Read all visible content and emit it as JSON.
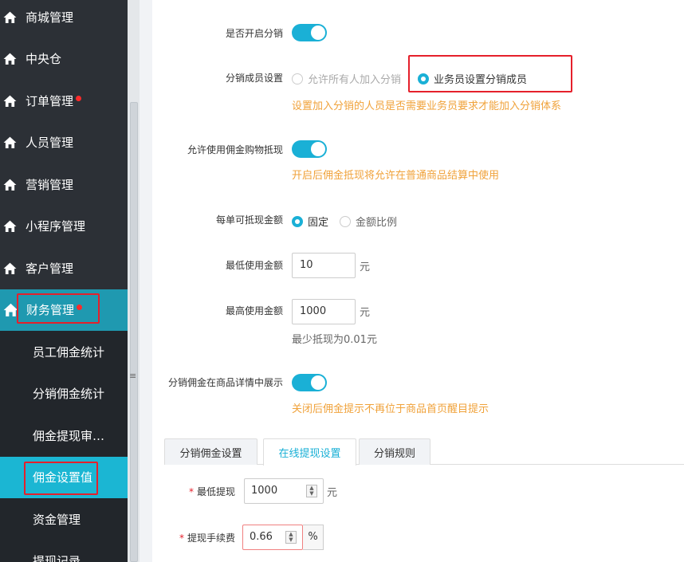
{
  "sidebar": {
    "items": [
      {
        "label": "商城管理"
      },
      {
        "label": "中央仓"
      },
      {
        "label": "订单管理"
      },
      {
        "label": "人员管理"
      },
      {
        "label": "营销管理"
      },
      {
        "label": "小程序管理"
      },
      {
        "label": "客户管理"
      },
      {
        "label": "财务管理"
      }
    ],
    "subitems": [
      {
        "label": "员工佣金统计"
      },
      {
        "label": "分销佣金统计"
      },
      {
        "label": "佣金提现审…"
      },
      {
        "label": "佣金设置值"
      },
      {
        "label": "资金管理"
      },
      {
        "label": "提现记录"
      }
    ],
    "splitter_grip": "≡"
  },
  "form": {
    "enable_distribution": {
      "label": "是否开启分销",
      "on": true
    },
    "member_setting": {
      "label": "分销成员设置",
      "options": [
        "允许所有人加入分销",
        "业务员设置分销成员"
      ],
      "selected": "业务员设置分销成员",
      "hint": "设置加入分销的人员是否需要业务员要求才能加入分销体系"
    },
    "commission_offset": {
      "label": "允许使用佣金购物抵现",
      "on": true,
      "hint": "开启后佣金抵现将允许在普通商品结算中使用"
    },
    "offset_amount": {
      "label": "每单可抵现金额",
      "options": [
        "固定",
        "金额比例"
      ],
      "selected": "固定"
    },
    "min_amount": {
      "label": "最低使用金额",
      "value": "10",
      "unit": "元"
    },
    "max_amount": {
      "label": "最高使用金额",
      "value": "1000",
      "unit": "元",
      "hint": "最少抵现为0.01元"
    },
    "show_in_detail": {
      "label": "分销佣金在商品详情中展示",
      "on": true,
      "hint": "关闭后佣金提示不再位于商品首页醒目提示"
    }
  },
  "tabs": [
    {
      "label": "分销佣金设置"
    },
    {
      "label": "在线提现设置"
    },
    {
      "label": "分销规则"
    }
  ],
  "active_tab": "在线提现设置",
  "withdraw": {
    "required_mark": "*",
    "min": {
      "label": "最低提现",
      "value": "1000",
      "unit": "元"
    },
    "fee": {
      "label": "提现手续费",
      "value": "0.66",
      "unit": "%"
    }
  },
  "colors": {
    "accent": "#1ab0d6",
    "sidebar_bg": "#2c3036",
    "highlight_box": "#e5202b",
    "hint": "#f0a23a",
    "badge": "#ff2a2a"
  }
}
